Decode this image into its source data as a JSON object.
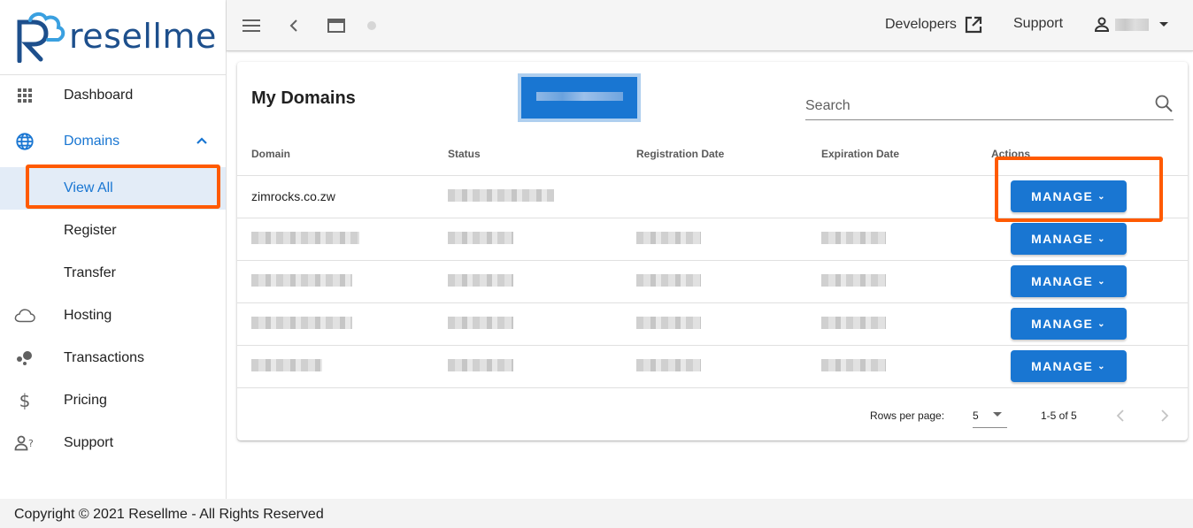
{
  "brand": {
    "name": "resellme",
    "primary_color": "#1976d2",
    "logo_dark": "#1d4f8c",
    "logo_light": "#3aa0e0",
    "highlight_color": "#ff5a00"
  },
  "sidebar": {
    "items": [
      {
        "label": "Dashboard",
        "icon": "apps-grid-icon"
      },
      {
        "label": "Domains",
        "icon": "globe-icon",
        "expanded": true,
        "children": [
          {
            "label": "View All",
            "active": true
          },
          {
            "label": "Register"
          },
          {
            "label": "Transfer"
          }
        ]
      },
      {
        "label": "Hosting",
        "icon": "cloud-icon"
      },
      {
        "label": "Transactions",
        "icon": "bubble-chart-icon"
      },
      {
        "label": "Pricing",
        "icon": "dollar-icon"
      },
      {
        "label": "Support",
        "icon": "person-help-icon"
      }
    ]
  },
  "topbar": {
    "icons": [
      "menu-icon",
      "back-chevron-icon",
      "window-icon",
      "status-dot-icon"
    ],
    "developers_label": "Developers",
    "support_label": "Support",
    "user_name": "[redacted]"
  },
  "main": {
    "title": "My Domains",
    "action_button_label": "[redacted]",
    "search": {
      "placeholder": "Search",
      "value": ""
    },
    "table": {
      "columns": [
        "Domain",
        "Status",
        "Registration Date",
        "Expiration Date",
        "Actions"
      ],
      "rows": [
        {
          "domain": "zimrocks.co.zw",
          "status": "[redacted]",
          "registration_date": "",
          "expiration_date": "",
          "action": "MANAGE"
        },
        {
          "domain": "[redacted]",
          "status": "[redacted]",
          "registration_date": "[redacted]",
          "expiration_date": "[redacted]",
          "action": "MANAGE"
        },
        {
          "domain": "[redacted]",
          "status": "[redacted]",
          "registration_date": "[redacted]",
          "expiration_date": "[redacted]",
          "action": "MANAGE"
        },
        {
          "domain": "[redacted]",
          "status": "[redacted]",
          "registration_date": "[redacted]",
          "expiration_date": "[redacted]",
          "action": "MANAGE"
        },
        {
          "domain": "[redacted]",
          "status": "[redacted]",
          "registration_date": "[redacted]",
          "expiration_date": "[redacted]",
          "action": "MANAGE"
        }
      ]
    },
    "pagination": {
      "rows_per_page_label": "Rows per page:",
      "rows_per_page": "5",
      "range": "1-5 of 5"
    }
  },
  "footer": {
    "text": "Copyright © 2021 Resellme - All Rights Reserved"
  }
}
